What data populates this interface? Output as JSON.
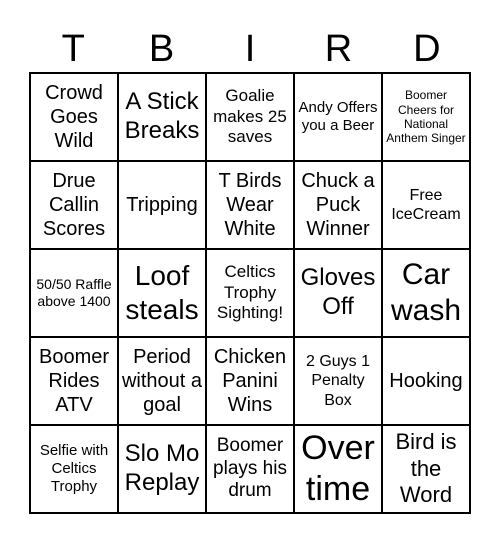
{
  "header": [
    "T",
    "B",
    "I",
    "R",
    "D"
  ],
  "cells": [
    "Crowd Goes Wild",
    "A Stick Breaks",
    "Goalie makes 25 saves",
    "Andy Offers you a Beer",
    "Boomer Cheers for National Anthem Singer",
    "Drue Callin Scores",
    "Tripping",
    "T Birds Wear White",
    "Chuck a Puck Winner",
    "Free IceCream",
    "50/50 Raffle above 1400",
    "Loof steals",
    "Celtics Trophy Sighting!",
    "Gloves Off",
    "Car wash",
    "Boomer Rides ATV",
    "Period without a goal",
    "Chicken Panini Wins",
    "2 Guys 1 Penalty Box",
    "Hooking",
    "Selfie with Celtics Trophy",
    "Slo Mo Replay",
    "Boomer plays his drum",
    "Over time",
    "Bird is the Word"
  ]
}
